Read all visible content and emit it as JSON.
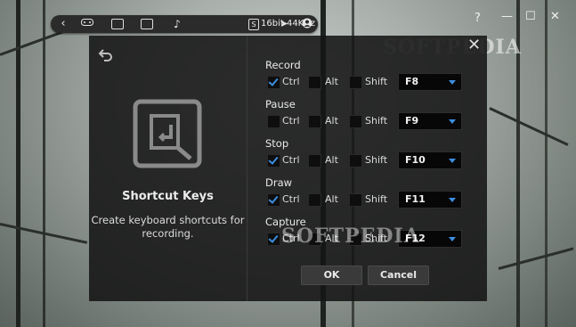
{
  "toolbar": {
    "audio_text": "16bit 44KHz",
    "s_badge": "S",
    "icons": [
      "chevron-left-icon",
      "gamepad-icon",
      "window-capture-icon",
      "fullscreen-capture-icon",
      "music-note-icon",
      "audio-badge-icon",
      "cursor-icon",
      "webcam-icon"
    ]
  },
  "window_controls": {
    "help": "?",
    "minimize": "—",
    "maximize": "☐",
    "close": "✕"
  },
  "dialog": {
    "title": "Shortcut Keys",
    "description": "Create keyboard shortcuts for recording.",
    "modifiers": {
      "ctrl": "Ctrl",
      "alt": "Alt",
      "shift": "Shift"
    },
    "shortcuts": [
      {
        "label": "Record",
        "ctrl": true,
        "alt": false,
        "shift": false,
        "key": "F8"
      },
      {
        "label": "Pause",
        "ctrl": false,
        "alt": false,
        "shift": false,
        "key": "F9"
      },
      {
        "label": "Stop",
        "ctrl": true,
        "alt": false,
        "shift": false,
        "key": "F10"
      },
      {
        "label": "Draw",
        "ctrl": true,
        "alt": false,
        "shift": false,
        "key": "F11"
      },
      {
        "label": "Capture",
        "ctrl": true,
        "alt": false,
        "shift": false,
        "key": "F12"
      }
    ],
    "ok_label": "OK",
    "cancel_label": "Cancel",
    "accent_color": "#3d8fe0"
  },
  "watermarks": {
    "top": "SOFTPEDIA",
    "middle": "SOFTPEDIA"
  }
}
